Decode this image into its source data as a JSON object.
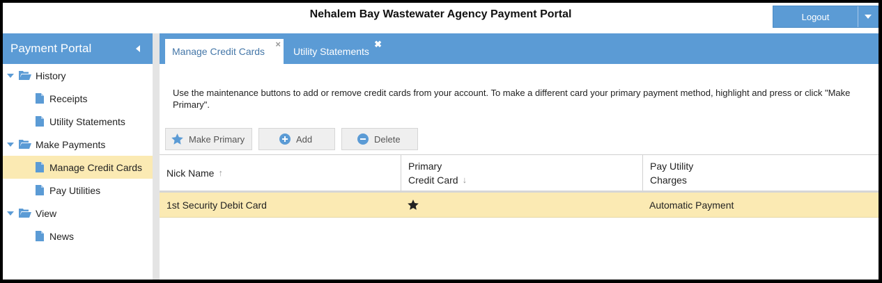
{
  "header": {
    "title": "Nehalem Bay Wastewater Agency Payment Portal",
    "logout_label": "Logout"
  },
  "sidebar": {
    "title": "Payment Portal",
    "groups": [
      {
        "label": "History",
        "items": [
          {
            "label": "Receipts"
          },
          {
            "label": "Utility Statements"
          }
        ]
      },
      {
        "label": "Make Payments",
        "items": [
          {
            "label": "Manage Credit Cards",
            "selected": true
          },
          {
            "label": "Pay Utilities"
          }
        ]
      },
      {
        "label": "View",
        "items": [
          {
            "label": "News"
          }
        ]
      }
    ]
  },
  "tabs": [
    {
      "label": "Manage Credit Cards",
      "active": true,
      "close": "×"
    },
    {
      "label": "Utility Statements",
      "active": false,
      "close": "✖"
    }
  ],
  "main": {
    "instructions": "Use the maintenance buttons to add or remove credit cards from your account. To make a different card your primary payment method, highlight and press or click \"Make Primary\".",
    "toolbar": {
      "make_primary": "Make Primary",
      "add": "Add",
      "delete": "Delete"
    },
    "table": {
      "columns": {
        "nick_name": "Nick Name",
        "primary_line1": "Primary",
        "primary_line2": "Credit Card",
        "pay_line1": "Pay Utility",
        "pay_line2": "Charges"
      },
      "sort_up": "↑",
      "sort_down": "↓",
      "rows": [
        {
          "nick_name": "1st Security Debit Card",
          "primary": true,
          "pay_utility": "Automatic Payment"
        }
      ]
    }
  },
  "colors": {
    "accent": "#5b9bd5",
    "selection": "#fbeab3"
  },
  "icons": {
    "sidebar_collapse": "chevron-left-icon",
    "folder": "folder-open-icon",
    "document": "document-icon",
    "make_primary": "star-icon",
    "add": "plus-circle-icon",
    "delete": "minus-circle-icon",
    "primary_marker": "star-icon"
  }
}
